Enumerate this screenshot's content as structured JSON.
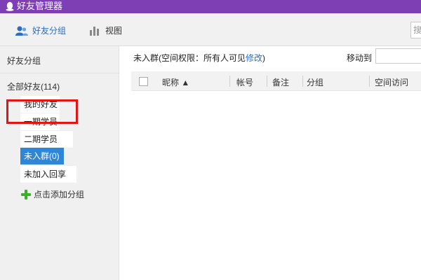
{
  "window": {
    "title": "好友管理器"
  },
  "toolbar": {
    "friend_groups_label": "好友分组",
    "view_label": "视图",
    "search_placeholder": "搜"
  },
  "sidebar": {
    "header": "好友分组",
    "all_friends": "全部好友(114)",
    "groups": [
      {
        "label": "我的好友",
        "selected": false
      },
      {
        "label": "一期学员",
        "selected": false
      },
      {
        "label": "二期学员",
        "selected": false
      },
      {
        "label": "未入群(0)",
        "selected": true
      },
      {
        "label": "未加入回享",
        "selected": false
      }
    ],
    "add_group_label": "点击添加分组"
  },
  "main": {
    "group_title": "未入群(空间权限：所有人可见",
    "edit_link": "修改",
    "group_title_suffix": ")",
    "move_to_label": "移动到",
    "columns": [
      "昵称 ▲",
      "帐号",
      "备注",
      "分组",
      "空间访问"
    ]
  },
  "colors": {
    "titlebar": "#7e3fb5",
    "accent_blue": "#2a6ebd",
    "selected_group": "#2f86d6",
    "highlight_box": "#e01515",
    "add_icon_green": "#3fae2a"
  }
}
